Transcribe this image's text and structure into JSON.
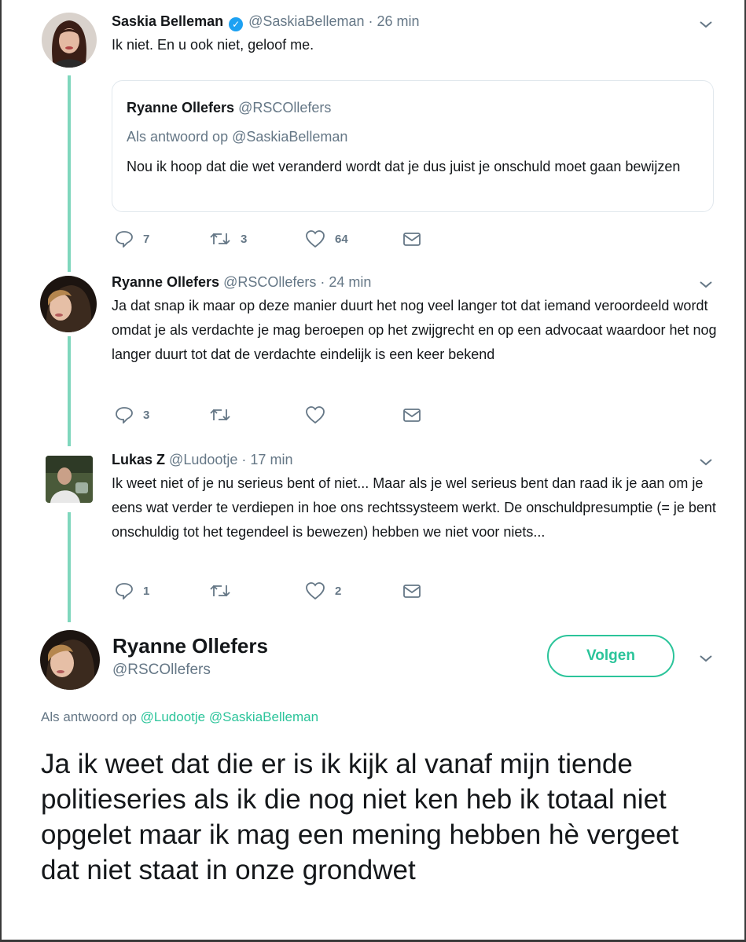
{
  "tweet1": {
    "name": "Saskia Belleman",
    "handle": "@SaskiaBelleman",
    "sep": "·",
    "time": "26 min",
    "text": "Ik niet. En u ook niet, geloof me.",
    "quote": {
      "name": "Ryanne Ollefers",
      "handle": "@RSCOllefers",
      "reply_prefix": "Als antwoord op",
      "reply_mention": "@SaskiaBelleman",
      "text": "Nou ik hoop dat die wet veranderd wordt dat je dus juist je onschuld moet gaan bewijzen"
    },
    "replies": "7",
    "retweets": "3",
    "likes": "64"
  },
  "tweet2": {
    "name": "Ryanne Ollefers",
    "handle": "@RSCOllefers",
    "sep": "·",
    "time": "24 min",
    "text": "Ja dat snap ik maar op deze manier duurt het nog veel langer tot dat iemand veroordeeld wordt omdat je als verdachte je mag beroepen op het zwijgrecht en op een advocaat waardoor het nog langer duurt tot dat de verdachte eindelijk is een keer bekend",
    "replies": "3",
    "retweets": "",
    "likes": ""
  },
  "tweet3": {
    "name": "Lukas Z",
    "handle": "@Ludootje",
    "sep": "·",
    "time": "17 min",
    "text": "Ik weet niet of je nu serieus bent of niet... Maar als je wel serieus bent dan raad ik je aan om je eens wat verder te verdiepen in hoe ons rechtssysteem werkt. De onschuldpresumptie (= je bent onschuldig tot het tegendeel is bewezen) hebben we niet voor niets...",
    "replies": "1",
    "retweets": "",
    "likes": "2"
  },
  "main": {
    "name": "Ryanne Ollefers",
    "handle": "@RSCOllefers",
    "follow_label": "Volgen",
    "reply_prefix": "Als antwoord op",
    "mention1": "@Ludootje",
    "mention2": "@SaskiaBelleman",
    "text": "Ja ik weet dat die er is ik kijk al vanaf mijn tiende politieseries als ik die nog niet ken heb ik totaal niet opgelet maar ik mag een mening hebben hè vergeet dat niet staat in onze grondwet"
  },
  "icons": {
    "reply": "reply-icon",
    "retweet": "retweet-icon",
    "like": "heart-icon",
    "dm": "envelope-icon",
    "more": "chevron-down-icon",
    "verified": "verified-badge-icon"
  },
  "colors": {
    "thread_line": "#7fd7bd",
    "accent": "#2bc49a",
    "muted": "#657786",
    "verified": "#1da1f2"
  }
}
